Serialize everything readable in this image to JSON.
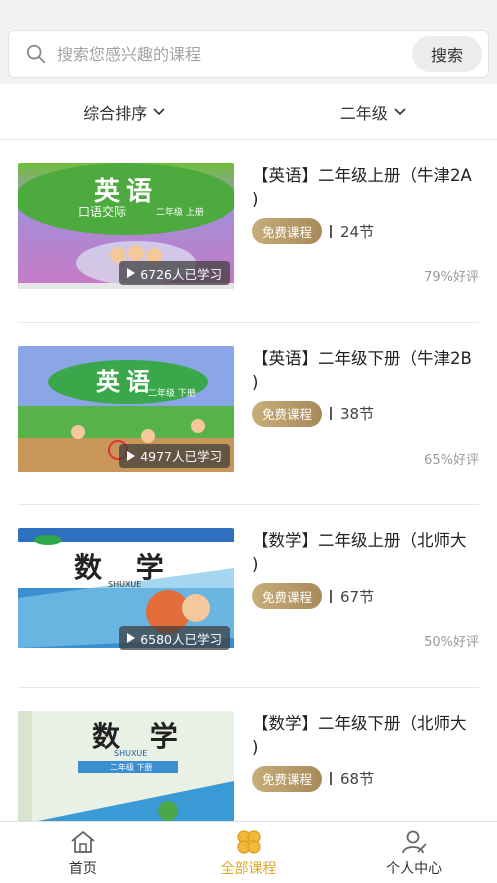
{
  "search": {
    "placeholder": "搜索您感兴趣的课程",
    "button_label": "搜索"
  },
  "filters": {
    "sort_label": "综合排序",
    "grade_label": "二年级"
  },
  "courses": [
    {
      "title_line1": "【英语】二年级上册（牛津2A",
      "title_line2": ")",
      "tag": "免费课程",
      "lessons": "24节",
      "learners": "6726人已学习",
      "rating": "79%好评",
      "cover_text": "英语",
      "cover_sub": "口语交际",
      "cover_grade": "二年级  上册"
    },
    {
      "title_line1": "【英语】二年级下册（牛津2B",
      "title_line2": ")",
      "tag": "免费课程",
      "lessons": "38节",
      "learners": "4977人已学习",
      "rating": "65%好评",
      "cover_text": "英语",
      "cover_grade": "二年级  下册"
    },
    {
      "title_line1": "【数学】二年级上册（北师大",
      "title_line2": ")",
      "tag": "免费课程",
      "lessons": "67节",
      "learners": "6580人已学习",
      "rating": "50%好评",
      "cover_text": "数 学",
      "cover_sub": "SHUXUE"
    },
    {
      "title_line1": "【数学】二年级下册（北师大",
      "title_line2": ")",
      "tag": "免费课程",
      "lessons": "68节",
      "rating": "",
      "cover_text": "数 学",
      "cover_sub": "SHUXUE",
      "cover_grade": "二年级  下册"
    }
  ],
  "tabbar": {
    "home": "首页",
    "all_courses": "全部课程",
    "profile": "个人中心"
  },
  "colors": {
    "accent": "#e3a82b",
    "tag_gold": "#b89a68"
  }
}
